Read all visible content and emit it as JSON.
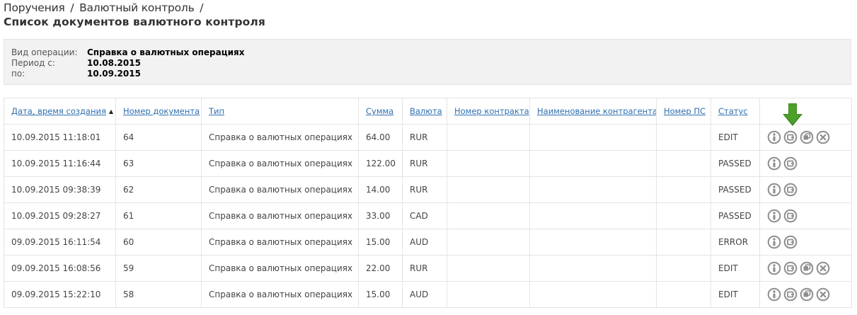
{
  "breadcrumb": {
    "item1": "Поручения",
    "separator": "/",
    "item2": "Валютный контроль",
    "trail": "/"
  },
  "page": {
    "title": "Список документов валютного контроля"
  },
  "filter": {
    "operation_label": "Вид операции:",
    "operation_value": "Справка о валютных операциях",
    "period_from_label": "Период с:",
    "period_from_value": "10.08.2015",
    "period_to_label": "по:",
    "period_to_value": "10.09.2015"
  },
  "table": {
    "columns": {
      "created": "Дата, время создания",
      "doc_number": "Номер документа",
      "type": "Тип",
      "amount": "Сумма",
      "currency": "Валюта",
      "contract_number": "Номер контракта",
      "counterparty": "Наименование контрагента",
      "ps_number": "Номер ПС",
      "status": "Статус"
    },
    "sort_indicator": "▲",
    "rows": [
      {
        "created": "10.09.2015 11:18:01",
        "doc_number": "64",
        "type": "Справка о валютных операциях",
        "amount": "64.00",
        "currency": "RUR",
        "contract_number": "",
        "counterparty": "",
        "ps_number": "",
        "status": "EDIT"
      },
      {
        "created": "10.09.2015 11:16:44",
        "doc_number": "63",
        "type": "Справка о валютных операциях",
        "amount": "122.00",
        "currency": "RUR",
        "contract_number": "",
        "counterparty": "",
        "ps_number": "",
        "status": "PASSED"
      },
      {
        "created": "10.09.2015 09:38:39",
        "doc_number": "62",
        "type": "Справка о валютных операциях",
        "amount": "14.00",
        "currency": "RUR",
        "contract_number": "",
        "counterparty": "",
        "ps_number": "",
        "status": "PASSED"
      },
      {
        "created": "10.09.2015 09:28:27",
        "doc_number": "61",
        "type": "Справка о валютных операциях",
        "amount": "33.00",
        "currency": "CAD",
        "contract_number": "",
        "counterparty": "",
        "ps_number": "",
        "status": "PASSED"
      },
      {
        "created": "09.09.2015 16:11:54",
        "doc_number": "60",
        "type": "Справка о валютных операциях",
        "amount": "15.00",
        "currency": "AUD",
        "contract_number": "",
        "counterparty": "",
        "ps_number": "",
        "status": "ERROR"
      },
      {
        "created": "09.09.2015 16:08:56",
        "doc_number": "59",
        "type": "Справка о валютных операциях",
        "amount": "22.00",
        "currency": "RUR",
        "contract_number": "",
        "counterparty": "",
        "ps_number": "",
        "status": "EDIT"
      },
      {
        "created": "09.09.2015 15:22:10",
        "doc_number": "58",
        "type": "Справка о валютных операциях",
        "amount": "15.00",
        "currency": "AUD",
        "contract_number": "",
        "counterparty": "",
        "ps_number": "",
        "status": "EDIT"
      }
    ]
  },
  "icons": {
    "info": "info-icon",
    "view": "view-icon",
    "copy": "copy-icon",
    "delete": "delete-icon",
    "pointer": "down-arrow-icon"
  },
  "colors": {
    "link": "#2f6fb0",
    "icon": "#8f8f8f",
    "pointer_arrow": "#3e8a1e",
    "panel_bg": "#f2f2f2"
  }
}
